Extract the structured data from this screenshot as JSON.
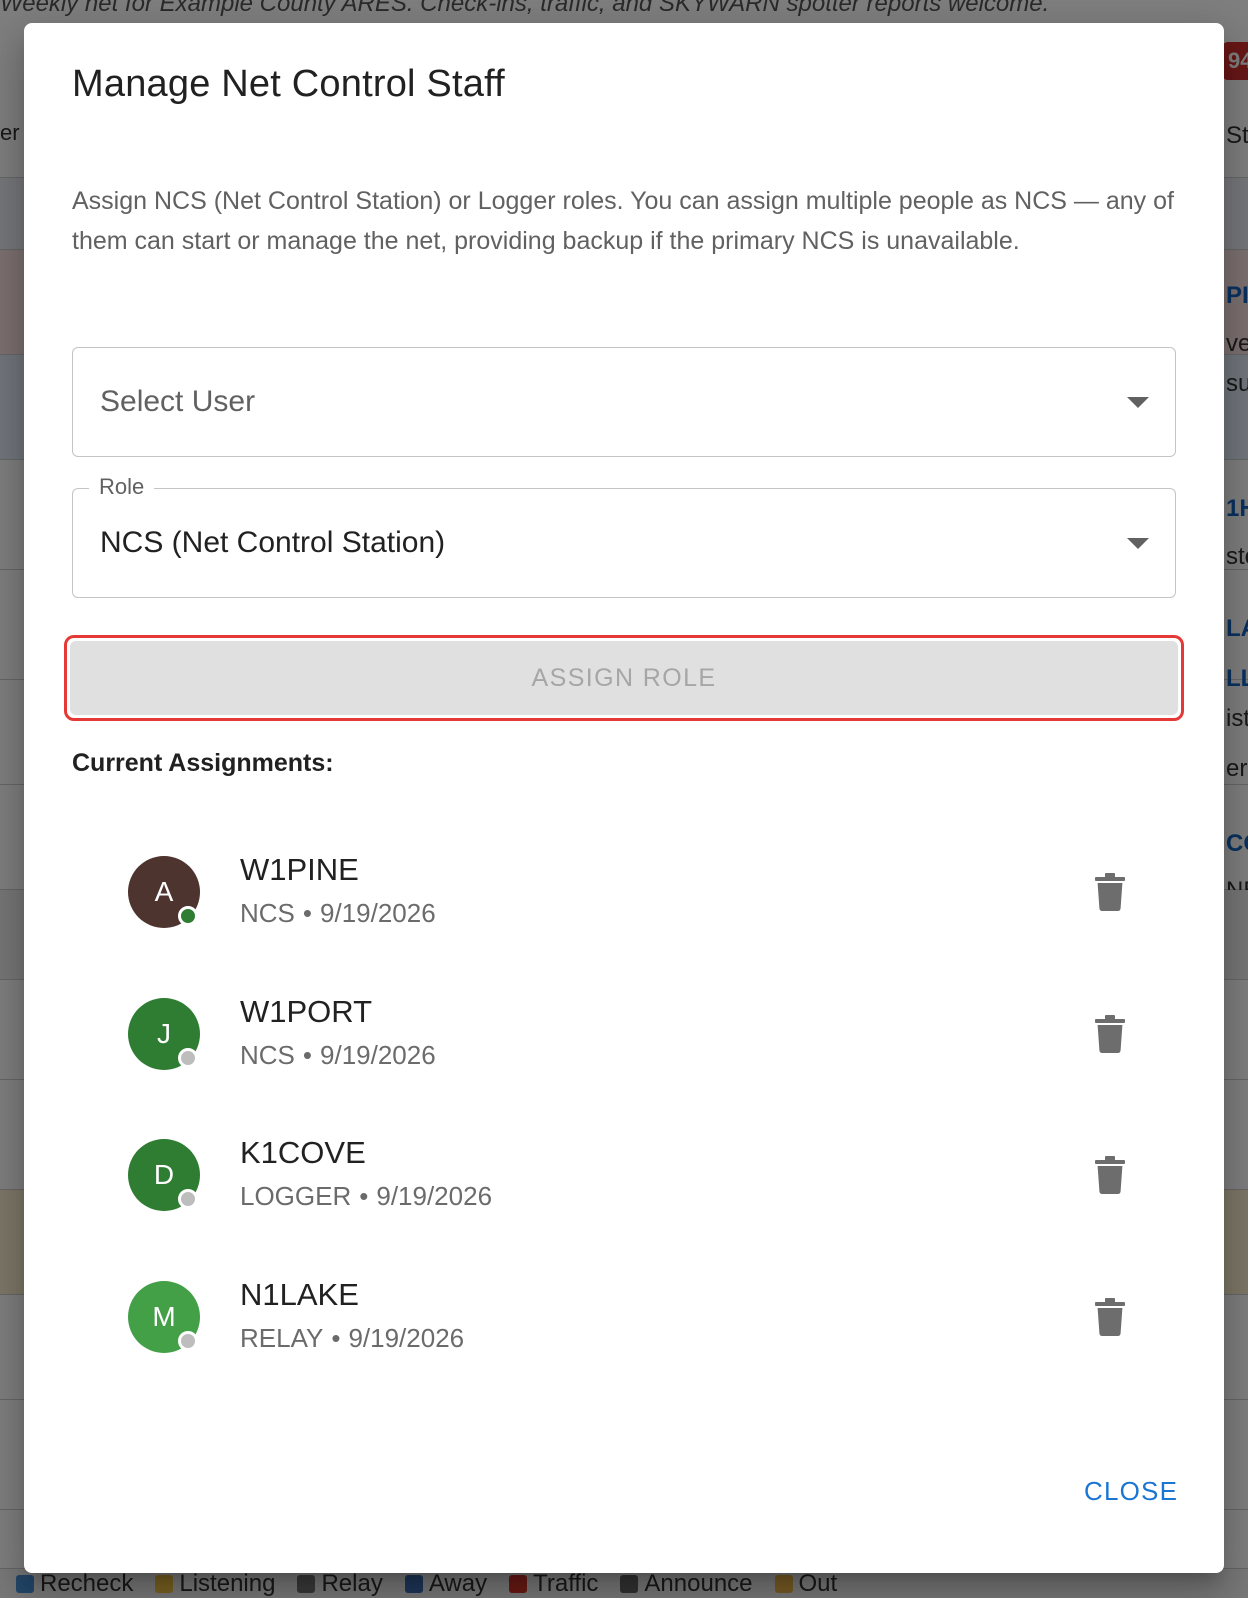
{
  "background": {
    "banner_text": "Weekly net for Example County ARES. Check-ins, traffic, and SKYWARN spotter reports welcome.",
    "badge": "94",
    "left_fragment": "er",
    "right_fragments": [
      "St",
      "PI",
      "ver",
      "su",
      "1H",
      "ste",
      "LA",
      "LL",
      "ist",
      "er",
      "CO",
      "NE"
    ],
    "legend": [
      "Recheck",
      "Listening",
      "Relay",
      "Away",
      "Traffic",
      "Announce",
      "Out"
    ]
  },
  "dialog": {
    "title": "Manage Net Control Staff",
    "description": "Assign NCS (Net Control Station) or Logger roles. You can assign multiple people as NCS — any of them can start or manage the net, providing backup if the primary NCS is unavailable.",
    "user_select": {
      "placeholder": "Select User"
    },
    "role_select": {
      "label": "Role",
      "value": "NCS (Net Control Station)"
    },
    "assign_button": "ASSIGN ROLE",
    "current_assignments_title": "Current Assignments:",
    "assignments": [
      {
        "initial": "A",
        "callsign": "W1PINE",
        "role": "NCS",
        "date": "9/19/2026",
        "avatar_color": "#4e342e",
        "presence": "online",
        "presence_color": "#2e7d32"
      },
      {
        "initial": "J",
        "callsign": "W1PORT",
        "role": "NCS",
        "date": "9/19/2026",
        "avatar_color": "#2e7d32",
        "presence": "offline",
        "presence_color": "#bdbdbd"
      },
      {
        "initial": "D",
        "callsign": "K1COVE",
        "role": "LOGGER",
        "date": "9/19/2026",
        "avatar_color": "#2e7d32",
        "presence": "offline",
        "presence_color": "#bdbdbd"
      },
      {
        "initial": "M",
        "callsign": "N1LAKE",
        "role": "RELAY",
        "date": "9/19/2026",
        "avatar_color": "#43a047",
        "presence": "offline",
        "presence_color": "#bdbdbd"
      }
    ],
    "close_button": "CLOSE"
  },
  "colors": {
    "accent": "#1976d2",
    "highlight_outline": "#e53935",
    "disabled_button_bg": "#e0e0e0",
    "disabled_button_text": "#a6a6a6"
  }
}
